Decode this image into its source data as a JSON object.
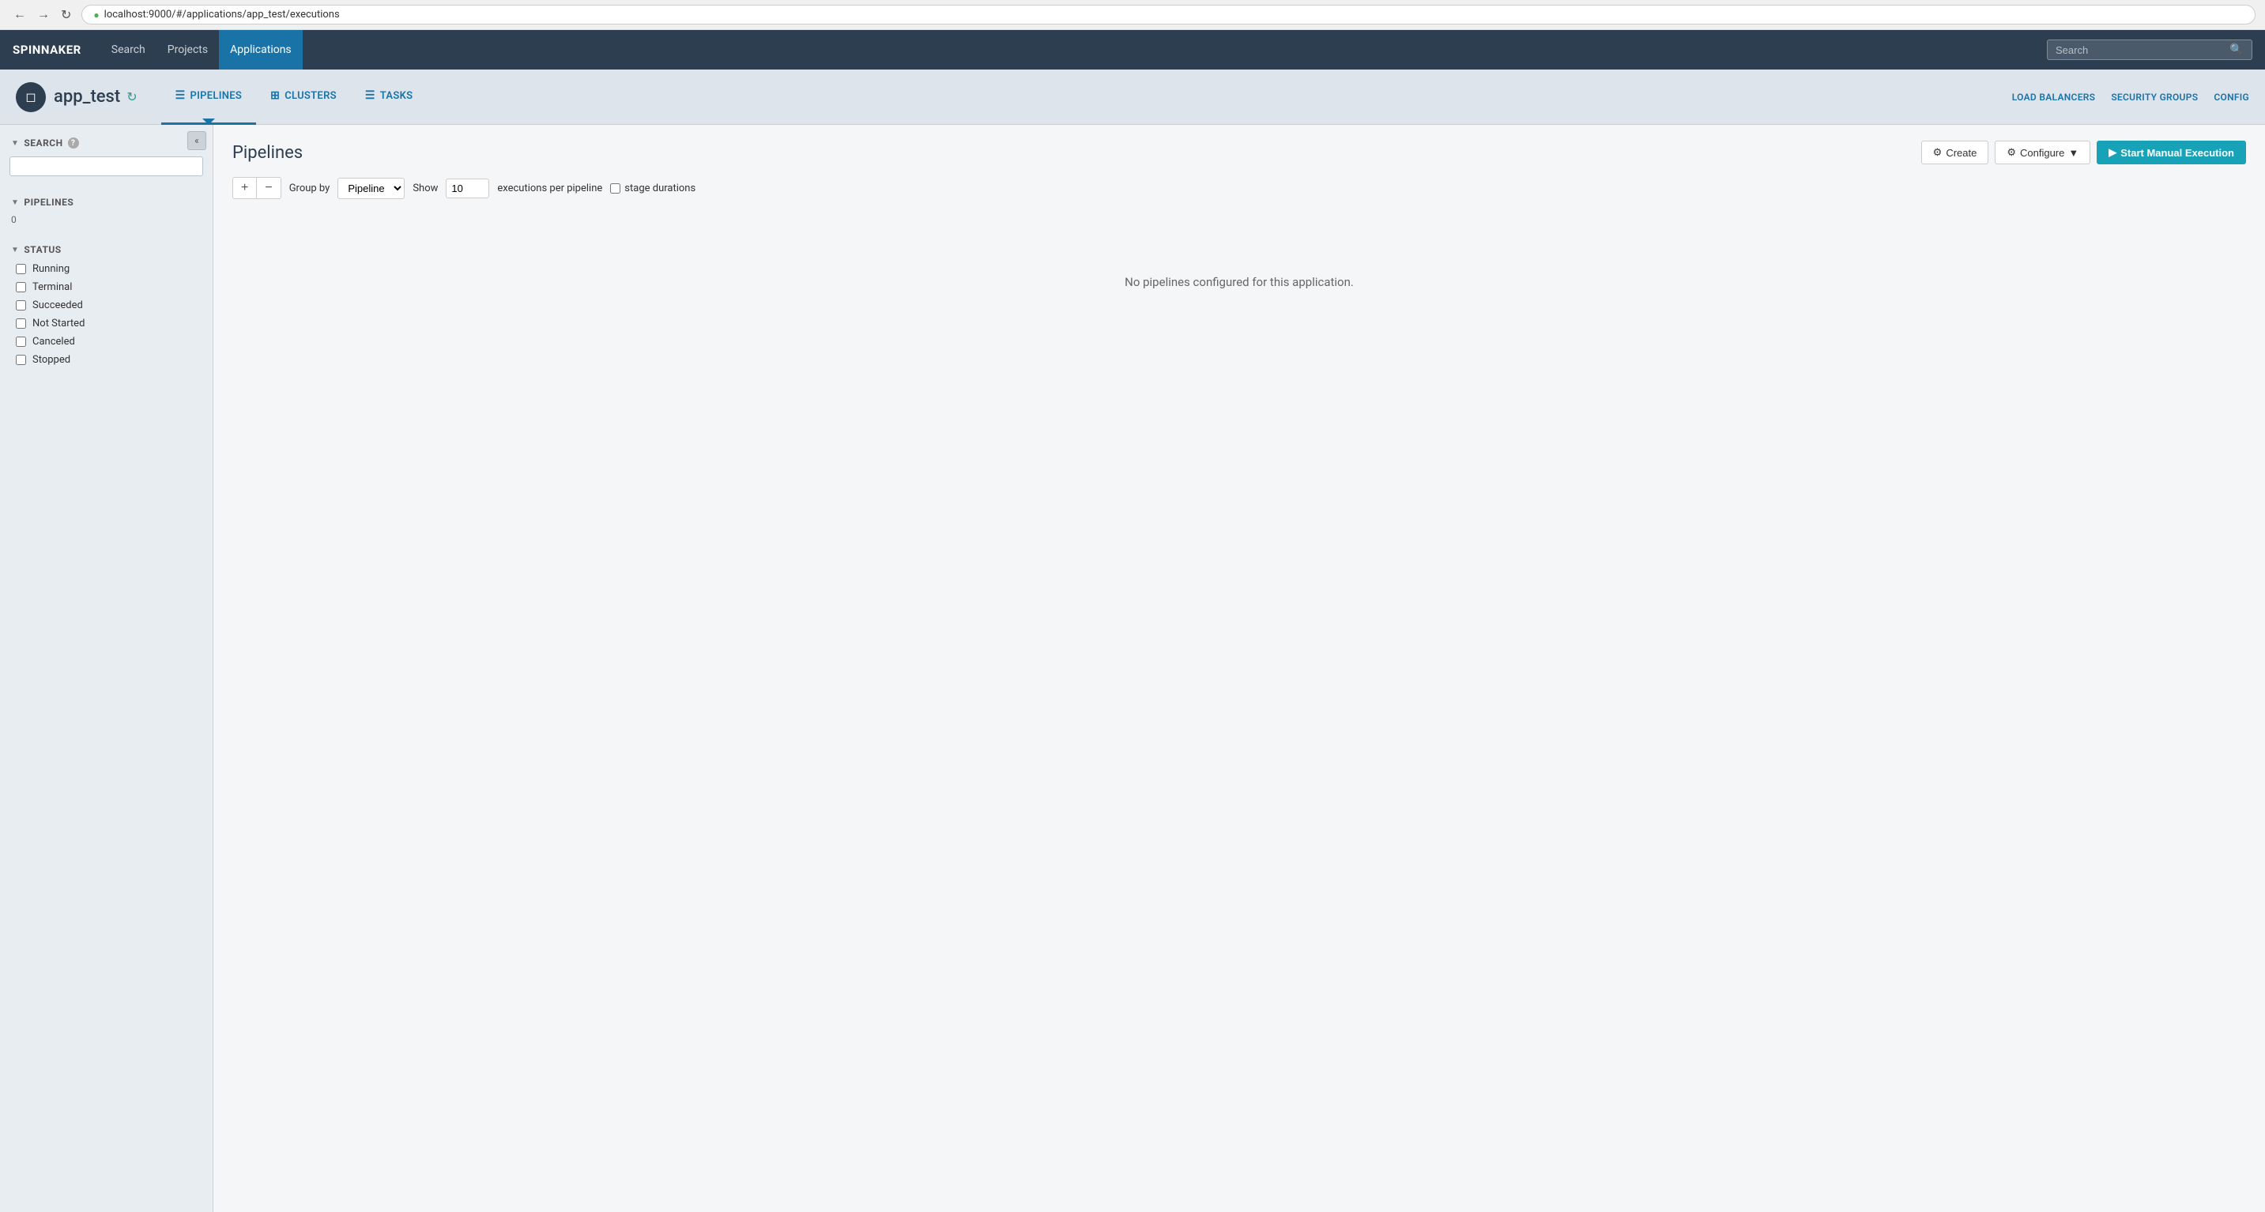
{
  "browser": {
    "url": "localhost:9000/#/applications/app_test/executions"
  },
  "topnav": {
    "brand": "SPINNAKER",
    "items": [
      {
        "label": "Search",
        "active": false
      },
      {
        "label": "Projects",
        "active": false
      },
      {
        "label": "Applications",
        "active": true
      }
    ],
    "search_placeholder": "Search"
  },
  "appheader": {
    "app_name": "app_test",
    "nav_items": [
      {
        "label": "PIPELINES",
        "icon": "≡",
        "active": true
      },
      {
        "label": "CLUSTERS",
        "icon": "⊞",
        "active": false
      },
      {
        "label": "TASKS",
        "icon": "≡",
        "active": false
      }
    ],
    "right_items": [
      {
        "label": "LOAD BALANCERS"
      },
      {
        "label": "SECURITY GROUPS"
      },
      {
        "label": "CONFIG"
      }
    ]
  },
  "sidebar": {
    "collapse_label": "«",
    "search_section": {
      "title": "SEARCH",
      "placeholder": ""
    },
    "pipelines_section": {
      "title": "PIPELINES",
      "count": "0"
    },
    "status_section": {
      "title": "STATUS",
      "items": [
        {
          "label": "Running"
        },
        {
          "label": "Terminal"
        },
        {
          "label": "Succeeded"
        },
        {
          "label": "Not Started"
        },
        {
          "label": "Canceled"
        },
        {
          "label": "Stopped"
        }
      ]
    }
  },
  "content": {
    "title": "Pipelines",
    "buttons": {
      "create": "Create",
      "configure": "Configure",
      "start_manual": "Start Manual Execution"
    },
    "toolbar": {
      "group_by_label": "Group by",
      "group_by_value": "Pipeline",
      "show_label": "Show",
      "show_value": "10",
      "executions_label": "executions per pipeline",
      "stage_durations_label": "stage durations"
    },
    "empty_message": "No pipelines configured for this application."
  }
}
